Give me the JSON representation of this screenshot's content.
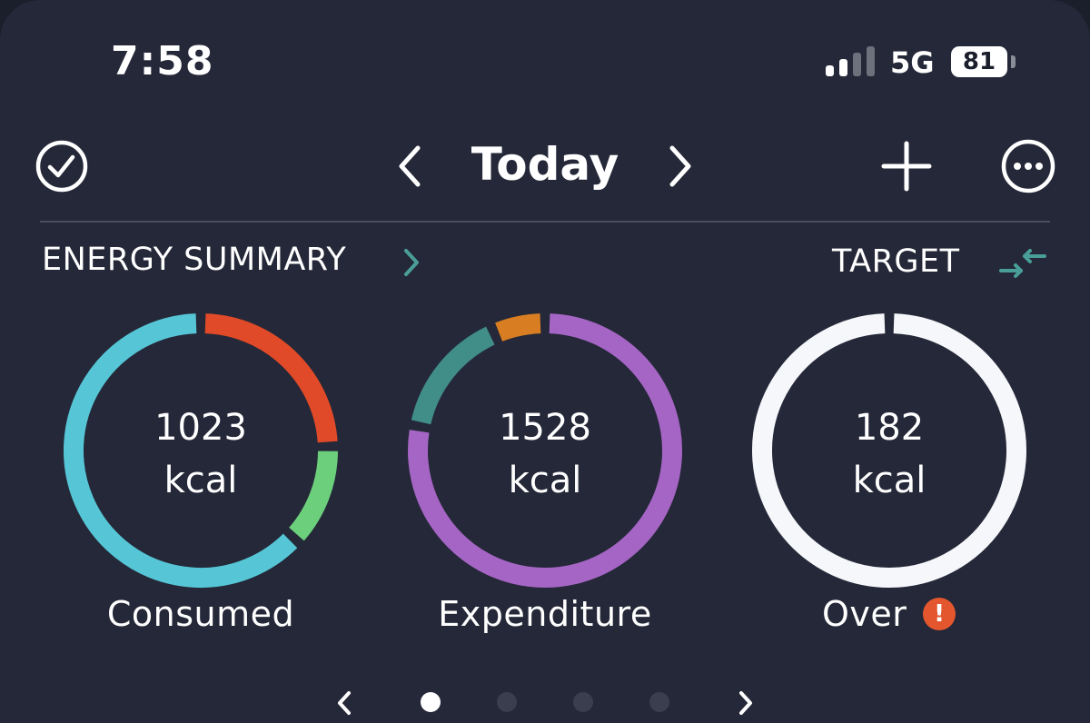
{
  "status_bar": {
    "time": "7:58",
    "network": "5G",
    "battery": "81"
  },
  "header": {
    "title": "Today"
  },
  "section": {
    "title": "ENERGY SUMMARY",
    "target_label": "TARGET"
  },
  "rings": [
    {
      "value": "1023",
      "unit": "kcal",
      "label": "Consumed",
      "segments": [
        {
          "color": "#e04a28",
          "fraction": 0.245
        },
        {
          "color": "#6ccf7c",
          "fraction": 0.125
        },
        {
          "color": "#56c6d6",
          "fraction": 0.63
        }
      ]
    },
    {
      "value": "1528",
      "unit": "kcal",
      "label": "Expenditure",
      "segments": [
        {
          "color": "#a565c4",
          "fraction": 0.78
        },
        {
          "color": "#418d88",
          "fraction": 0.155
        },
        {
          "color": "#d87d22",
          "fraction": 0.065
        }
      ]
    },
    {
      "value": "182",
      "unit": "kcal",
      "label": "Over",
      "segments": [
        {
          "color": "#f6f7fb",
          "fraction": 1.0
        }
      ]
    }
  ],
  "colors": {
    "accent": "#4a9e98",
    "warning": "#e4572e",
    "background": "#242838"
  },
  "pager": {
    "count": 4,
    "active": 0
  }
}
